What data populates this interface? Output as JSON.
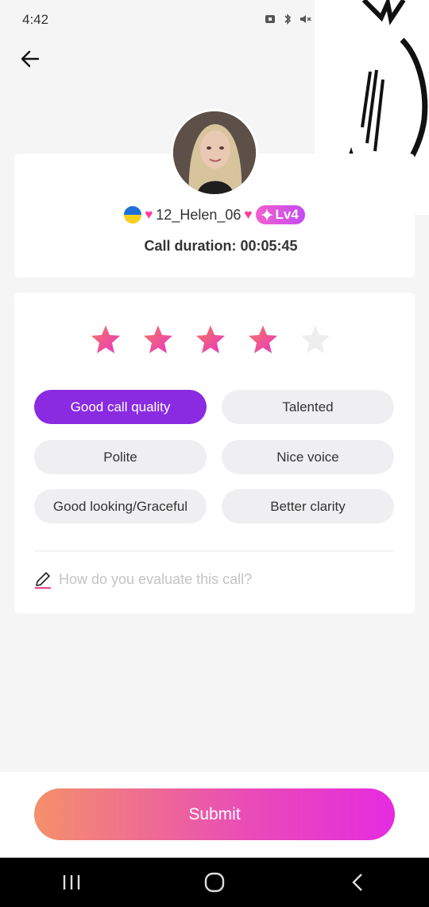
{
  "status_bar": {
    "time": "4:42"
  },
  "profile": {
    "name": "12_Helen_06",
    "level": "Lv4",
    "duration_label": "Call duration: 00:05:45"
  },
  "rating": {
    "value": 4,
    "max": 5
  },
  "tags": [
    {
      "label": "Good call quality",
      "selected": true
    },
    {
      "label": "Talented",
      "selected": false
    },
    {
      "label": "Polite",
      "selected": false
    },
    {
      "label": "Nice voice",
      "selected": false
    },
    {
      "label": "Good looking/Graceful",
      "selected": false
    },
    {
      "label": "Better clarity",
      "selected": false
    }
  ],
  "comment": {
    "placeholder": "How do you evaluate this call?",
    "value": ""
  },
  "submit_label": "Submit",
  "colors": {
    "accent": "#8a2be2",
    "star_filled": "#f0479d",
    "star_empty": "#eeeeee",
    "tag_bg": "#efeff1"
  }
}
